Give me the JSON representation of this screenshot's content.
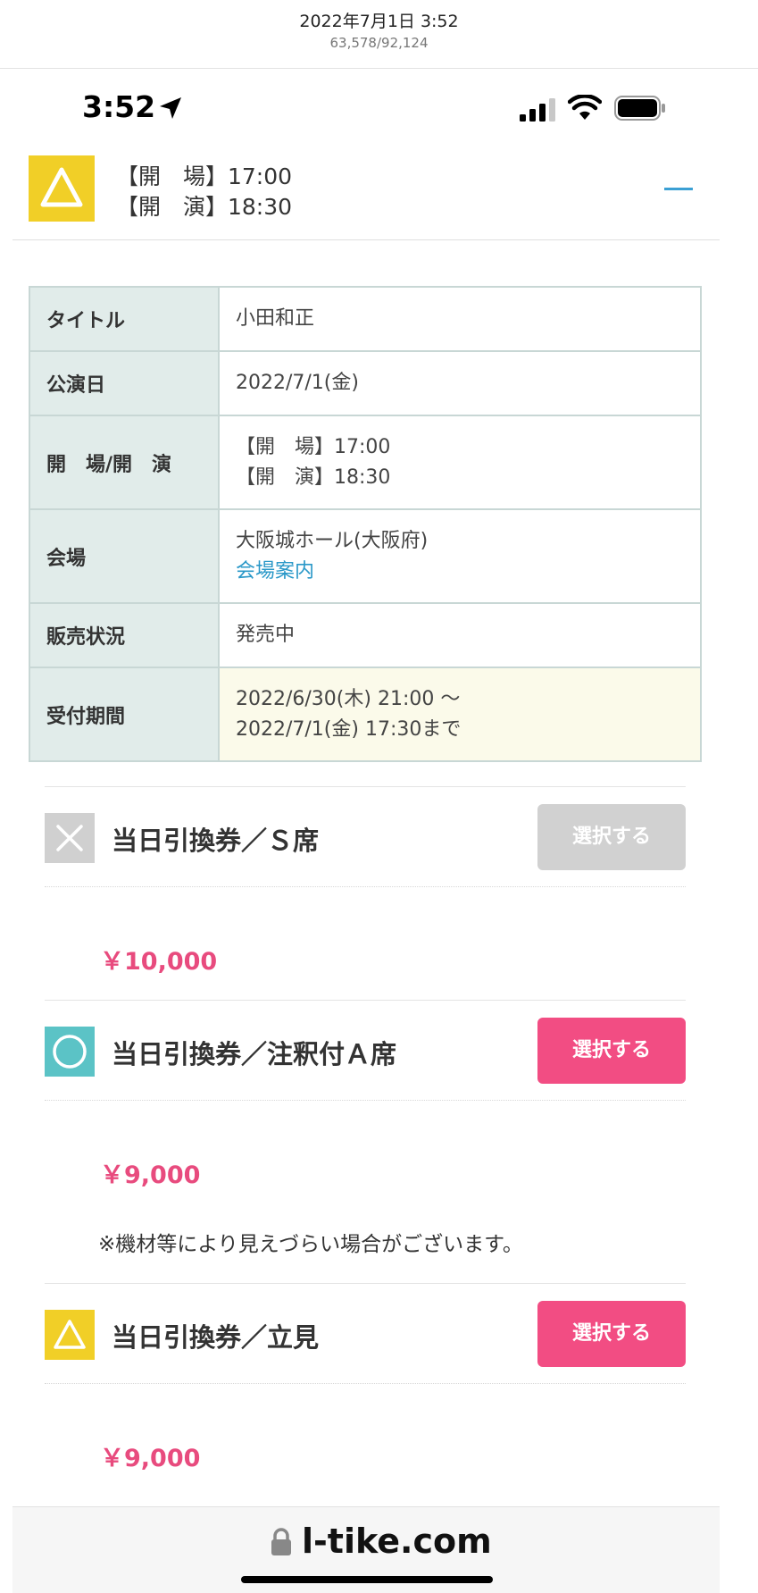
{
  "capture": {
    "datetime": "2022年7月1日 3:52",
    "counter": "63,578/92,124"
  },
  "status_bar": {
    "time": "3:52",
    "icons": [
      "location-arrow-icon",
      "cellular-signal-icon",
      "wifi-icon",
      "battery-icon"
    ]
  },
  "schedule": {
    "availability_icon": "triangle-icon",
    "open_time": "【開　場】17:00",
    "start_time": "【開　演】18:30",
    "collapse_icon": "minus-icon"
  },
  "info_table": {
    "title_label": "タイトル",
    "title_value": "小田和正",
    "date_label": "公演日",
    "date_value": "2022/7/1(金)",
    "times_label": "開　場/開　演",
    "times_open": "【開　場】17:00",
    "times_start": "【開　演】18:30",
    "venue_label": "会場",
    "venue_value": "大阪城ホール(大阪府)",
    "venue_link": "会場案内",
    "sales_label": "販売状況",
    "sales_value": "発売中",
    "period_label": "受付期間",
    "period_from": "2022/6/30(木) 21:00 〜",
    "period_to": "2022/7/1(金) 17:30まで"
  },
  "tickets": [
    {
      "icon": "cross-icon",
      "status": "sold-out",
      "name": "当日引換券／Ｓ席",
      "button": "選択する",
      "price": "￥10,000",
      "note": ""
    },
    {
      "icon": "circle-icon",
      "status": "available",
      "name": "当日引換券／注釈付Ａ席",
      "button": "選択する",
      "price": "￥9,000",
      "note": "※機材等により見えづらい場合がございます。"
    },
    {
      "icon": "triangle-icon",
      "status": "few-left",
      "name": "当日引換券／立見",
      "button": "選択する",
      "price": "￥9,000",
      "note": ""
    }
  ],
  "browser": {
    "url": "l-tike.com",
    "lock_icon": "lock-icon"
  },
  "colors": {
    "accent_pink": "#f24d83",
    "price_pink": "#e84b7e",
    "link_blue": "#2a98c8",
    "triangle_yellow": "#f1cf27",
    "circle_teal": "#5bc3c6",
    "disabled_gray": "#d1d1d1"
  }
}
